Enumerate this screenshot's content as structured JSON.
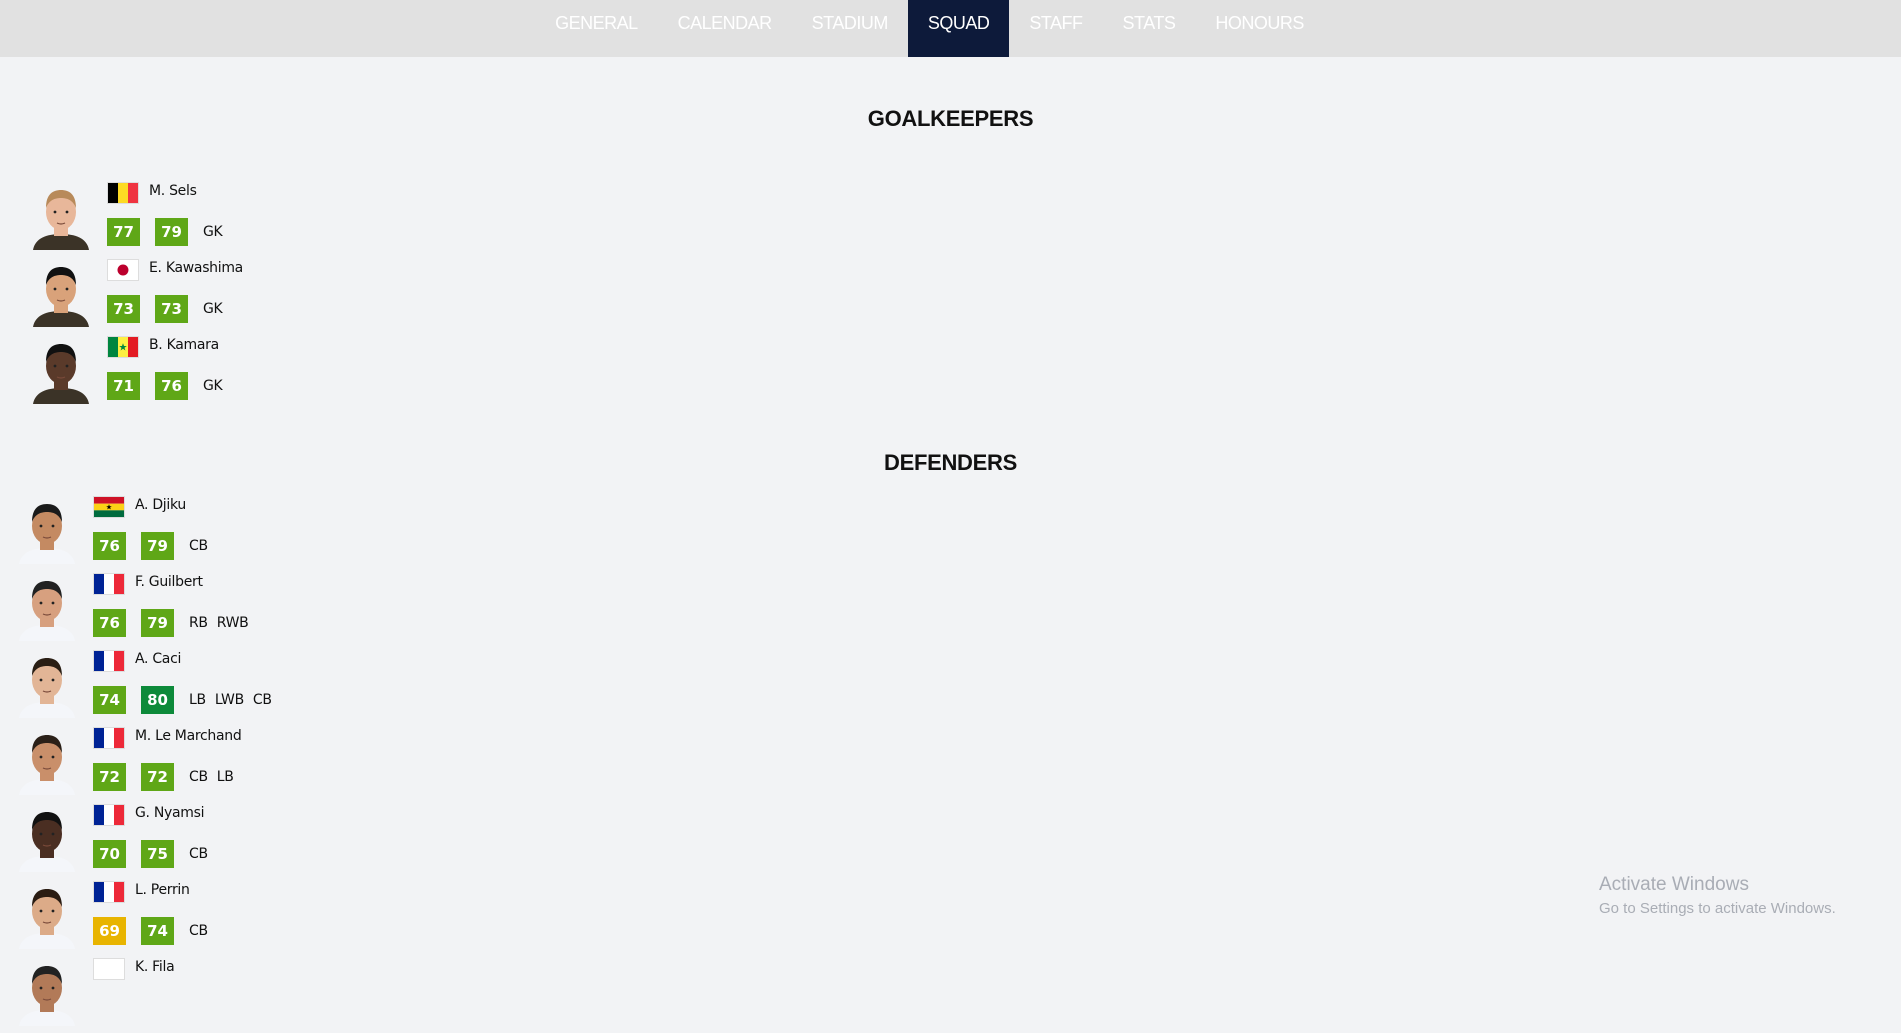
{
  "nav": {
    "tabs": [
      "GENERAL",
      "CALENDAR",
      "STADIUM",
      "SQUAD",
      "STAFF",
      "STATS",
      "HONOURS"
    ],
    "active": "SQUAD",
    "active_color": "#0d1a3a"
  },
  "rating_colors": {
    "green": "#5fa717",
    "dark_green": "#0d8a3a",
    "yellow": "#e8b400"
  },
  "sections": [
    {
      "title": "GOALKEEPERS",
      "players": [
        {
          "name": "M. Sels",
          "flag": "belgium",
          "overall": "77",
          "potential": "79",
          "overall_color": "#5fa717",
          "potential_color": "#5fa717",
          "positions": [
            "GK"
          ]
        },
        {
          "name": "E. Kawashima",
          "flag": "japan",
          "overall": "73",
          "potential": "73",
          "overall_color": "#5fa717",
          "potential_color": "#5fa717",
          "positions": [
            "GK"
          ]
        },
        {
          "name": "B. Kamara",
          "flag": "senegal",
          "overall": "71",
          "potential": "76",
          "overall_color": "#5fa717",
          "potential_color": "#5fa717",
          "positions": [
            "GK"
          ]
        }
      ]
    },
    {
      "title": "DEFENDERS",
      "players": [
        {
          "name": "A. Djiku",
          "flag": "ghana",
          "overall": "76",
          "potential": "79",
          "overall_color": "#5fa717",
          "potential_color": "#5fa717",
          "positions": [
            "CB"
          ]
        },
        {
          "name": "F. Guilbert",
          "flag": "france",
          "overall": "76",
          "potential": "79",
          "overall_color": "#5fa717",
          "potential_color": "#5fa717",
          "positions": [
            "RB",
            "RWB"
          ]
        },
        {
          "name": "A. Caci",
          "flag": "france",
          "overall": "74",
          "potential": "80",
          "overall_color": "#5fa717",
          "potential_color": "#0d8a3a",
          "positions": [
            "LB",
            "LWB",
            "CB"
          ]
        },
        {
          "name": "M. Le Marchand",
          "flag": "france",
          "overall": "72",
          "potential": "72",
          "overall_color": "#5fa717",
          "potential_color": "#5fa717",
          "positions": [
            "CB",
            "LB"
          ]
        },
        {
          "name": "G. Nyamsi",
          "flag": "france",
          "overall": "70",
          "potential": "75",
          "overall_color": "#5fa717",
          "potential_color": "#5fa717",
          "positions": [
            "CB"
          ]
        },
        {
          "name": "L. Perrin",
          "flag": "france",
          "overall": "69",
          "potential": "74",
          "overall_color": "#e8b400",
          "potential_color": "#5fa717",
          "positions": [
            "CB"
          ]
        },
        {
          "name": "K. Fila",
          "flag": "",
          "overall": "",
          "potential": "",
          "overall_color": "#5fa717",
          "potential_color": "#5fa717",
          "positions": []
        }
      ]
    }
  ],
  "watermark": {
    "line1": "Activate Windows",
    "line2": "Go to Settings to activate Windows."
  }
}
